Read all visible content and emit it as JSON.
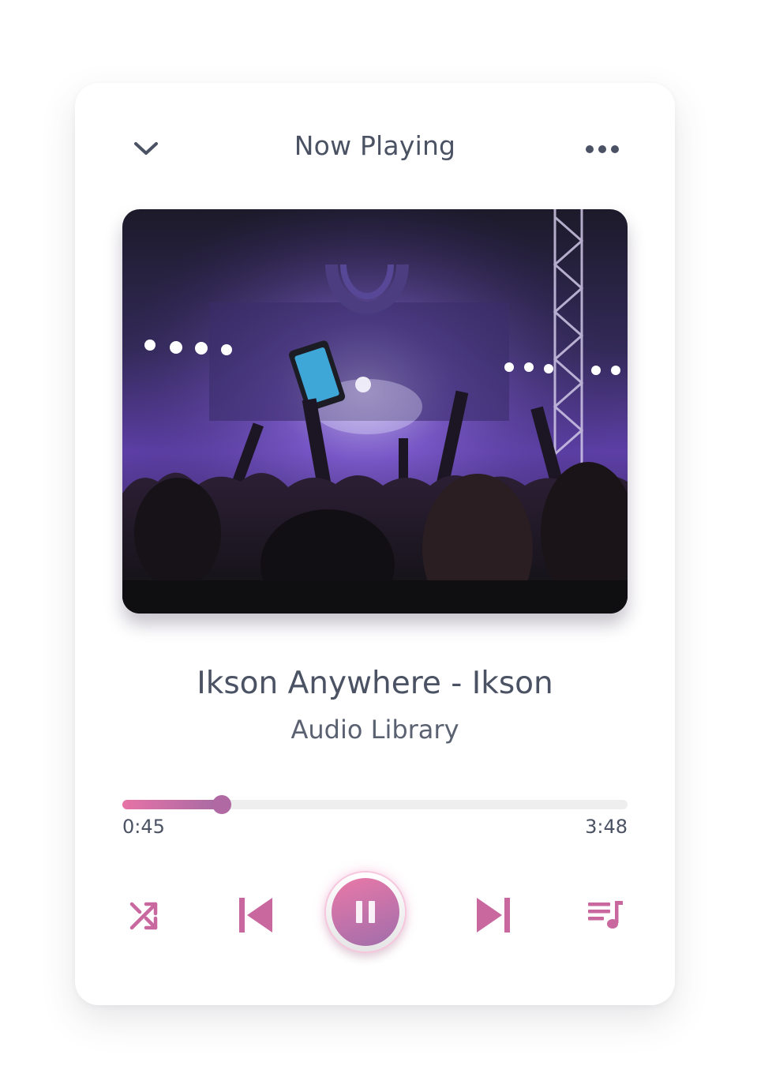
{
  "header": {
    "title": "Now Playing",
    "collapse_icon": "chevron-down-icon",
    "menu_icon": "more-horizontal-icon"
  },
  "track": {
    "title": "Ikson Anywhere - Ikson",
    "artist": "Audio Library",
    "artwork": "concert crowd with purple stage lights"
  },
  "progress": {
    "current": "0:45",
    "total": "3:48",
    "fraction": 0.197
  },
  "controls": {
    "shuffle_icon": "shuffle-icon",
    "previous_icon": "skip-previous-icon",
    "play_pause_icon": "pause-icon",
    "next_icon": "skip-next-icon",
    "queue_icon": "queue-music-icon"
  },
  "colors": {
    "accent_pink": "#e673a6",
    "accent_purple": "#a66aa4",
    "text": "#4a5263"
  }
}
